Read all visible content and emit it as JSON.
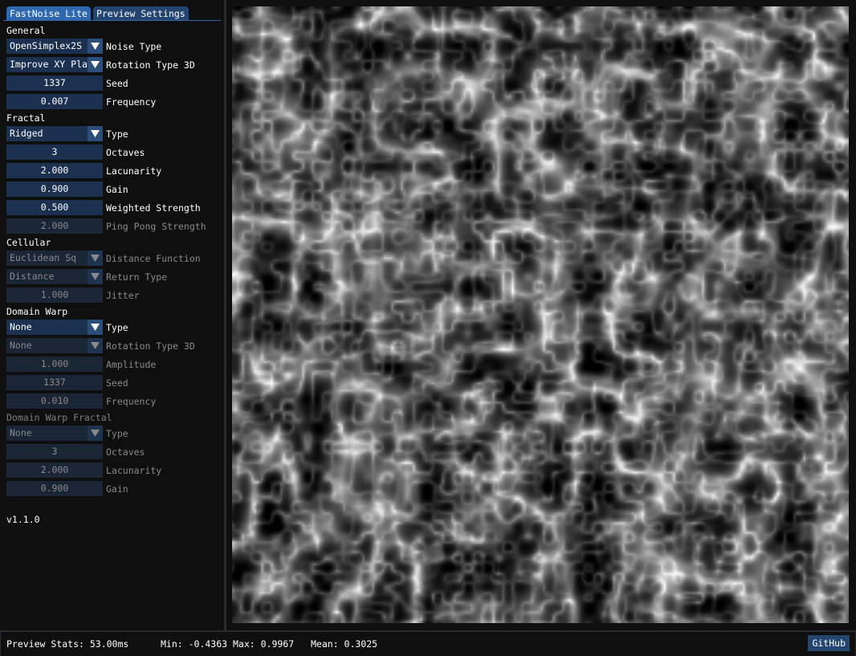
{
  "tabs": [
    {
      "label": "FastNoise Lite",
      "active": true
    },
    {
      "label": "Preview Settings",
      "active": false
    }
  ],
  "general": {
    "title": "General",
    "noise_type": {
      "value": "OpenSimplex2S",
      "label": "Noise Type"
    },
    "rotation_type_3d": {
      "value": "Improve XY Pla",
      "label": "Rotation Type 3D"
    },
    "seed": {
      "value": "1337",
      "label": "Seed"
    },
    "frequency": {
      "value": "0.007",
      "label": "Frequency"
    }
  },
  "fractal": {
    "title": "Fractal",
    "type": {
      "value": "Ridged",
      "label": "Type"
    },
    "octaves": {
      "value": "3",
      "label": "Octaves"
    },
    "lacunarity": {
      "value": "2.000",
      "label": "Lacunarity"
    },
    "gain": {
      "value": "0.900",
      "label": "Gain"
    },
    "weighted_strength": {
      "value": "0.500",
      "label": "Weighted Strength"
    },
    "ping_pong_strength": {
      "value": "2.000",
      "label": "Ping Pong Strength"
    }
  },
  "cellular": {
    "title": "Cellular",
    "distance_function": {
      "value": "Euclidean Sq",
      "label": "Distance Function"
    },
    "return_type": {
      "value": "Distance",
      "label": "Return Type"
    },
    "jitter": {
      "value": "1.000",
      "label": "Jitter"
    }
  },
  "domain_warp": {
    "title": "Domain Warp",
    "type": {
      "value": "None",
      "label": "Type"
    },
    "rotation_type_3d": {
      "value": "None",
      "label": "Rotation Type 3D"
    },
    "amplitude": {
      "value": "1.000",
      "label": "Amplitude"
    },
    "seed": {
      "value": "1337",
      "label": "Seed"
    },
    "frequency": {
      "value": "0.010",
      "label": "Frequency"
    }
  },
  "domain_warp_fractal": {
    "title": "Domain Warp Fractal",
    "type": {
      "value": "None",
      "label": "Type"
    },
    "octaves": {
      "value": "3",
      "label": "Octaves"
    },
    "lacunarity": {
      "value": "2.000",
      "label": "Lacunarity"
    },
    "gain": {
      "value": "0.900",
      "label": "Gain"
    }
  },
  "version": "v1.1.0",
  "status": {
    "preview_stats": "Preview Stats: 53.00ms",
    "min": "Min: -0.4363",
    "max": "Max: 0.9967",
    "mean": "Mean: 0.3025",
    "github_label": "GitHub"
  },
  "colors": {
    "accent": "#3068b0",
    "frame_bg": "#1c3050",
    "window_bg": "#0f0f10"
  }
}
